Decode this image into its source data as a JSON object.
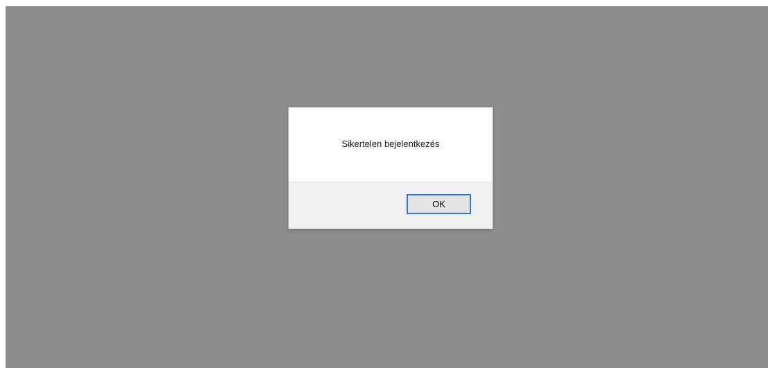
{
  "dialog": {
    "message": "Sikertelen bejelentkezés",
    "ok_label": "OK"
  },
  "colors": {
    "backdrop": "#8c8c8c",
    "dialog_body": "#ffffff",
    "dialog_footer": "#f0f0f0",
    "button_focus_border": "#2b7bd6"
  }
}
